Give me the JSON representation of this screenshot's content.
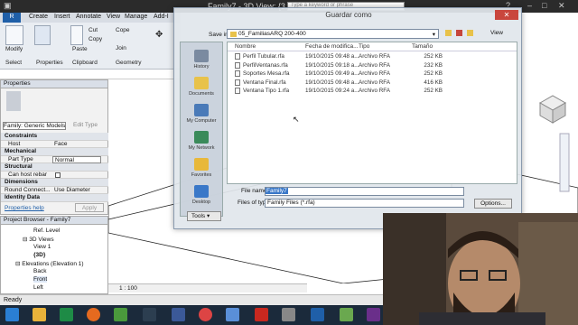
{
  "titlebar": {
    "title": "Family7 - 3D View: {3...",
    "search_placeholder": "Type a keyword or phrase"
  },
  "menu": {
    "file": "R",
    "items": [
      "Create",
      "Insert",
      "Annotate",
      "View",
      "Manage",
      "Add-I"
    ]
  },
  "ribbon": {
    "buttons": [
      "Modify",
      "Properties",
      "Paste",
      "Cut",
      "Copy",
      "Join"
    ],
    "panels": [
      "Select",
      "Properties",
      "Clipboard",
      "Geometry"
    ]
  },
  "properties": {
    "header": "Properties",
    "type_selector": "Family: Generic Models",
    "edit_type": "Edit Type",
    "rows": [
      {
        "section": "Constraints"
      },
      {
        "key": "Host",
        "value": "Face"
      },
      {
        "section": "Mechanical"
      },
      {
        "key": "Part Type",
        "value": "Normal"
      },
      {
        "section": "Structural"
      },
      {
        "key": "Can host rebar",
        "value": ""
      },
      {
        "section": "Dimensions"
      },
      {
        "key": "Round Connect...",
        "value": "Use Diameter"
      },
      {
        "section": "Identity Data"
      }
    ],
    "help_link": "Properties help",
    "apply": "Apply"
  },
  "browser": {
    "header": "Project Browser - Family7",
    "items": [
      "Ref. Level",
      "3D Views",
      "View 1",
      "{3D}",
      "Elevations (Elevation 1)",
      "Back",
      "Front",
      "Left"
    ]
  },
  "viewctl": {
    "scale": "1 : 100"
  },
  "status": "Ready",
  "dialog": {
    "title": "Guardar como",
    "close": "✕",
    "save_in_label": "Save in:",
    "save_in_value": "05_FamiliasARQ 200-400",
    "view_menu": "View",
    "places": [
      "History",
      "Documents",
      "My Computer",
      "My Network",
      "Favorites",
      "Desktop"
    ],
    "columns": [
      "Nombre",
      "Fecha de modifica...",
      "Tipo",
      "Tamaño"
    ],
    "files": [
      {
        "name": "Perfil Tubular.rfa",
        "date": "19/10/2015 09:48 a...",
        "type": "Archivo RFA",
        "size": "252 KB"
      },
      {
        "name": "PerfilVentanas.rfa",
        "date": "19/10/2015 09:18 a...",
        "type": "Archivo RFA",
        "size": "232 KB"
      },
      {
        "name": "Soportes Mesa.rfa",
        "date": "19/10/2015 09:49 a...",
        "type": "Archivo RFA",
        "size": "252 KB"
      },
      {
        "name": "Ventana Final.rfa",
        "date": "19/10/2015 09:48 a...",
        "type": "Archivo RFA",
        "size": "416 KB"
      },
      {
        "name": "Ventana Tipo 1.rfa",
        "date": "19/10/2015 09:24 a...",
        "type": "Archivo RFA",
        "size": "252 KB"
      }
    ],
    "filename_label": "File name:",
    "filename_value": "Family7",
    "filetype_label": "Files of type:",
    "filetype_value": "Family Files  (*.rfa)",
    "tools": "Tools",
    "options": "Options..."
  },
  "colors": {
    "accent": "#1f5fa8",
    "close": "#c9463d",
    "taskbar": "#1b2a3b"
  }
}
